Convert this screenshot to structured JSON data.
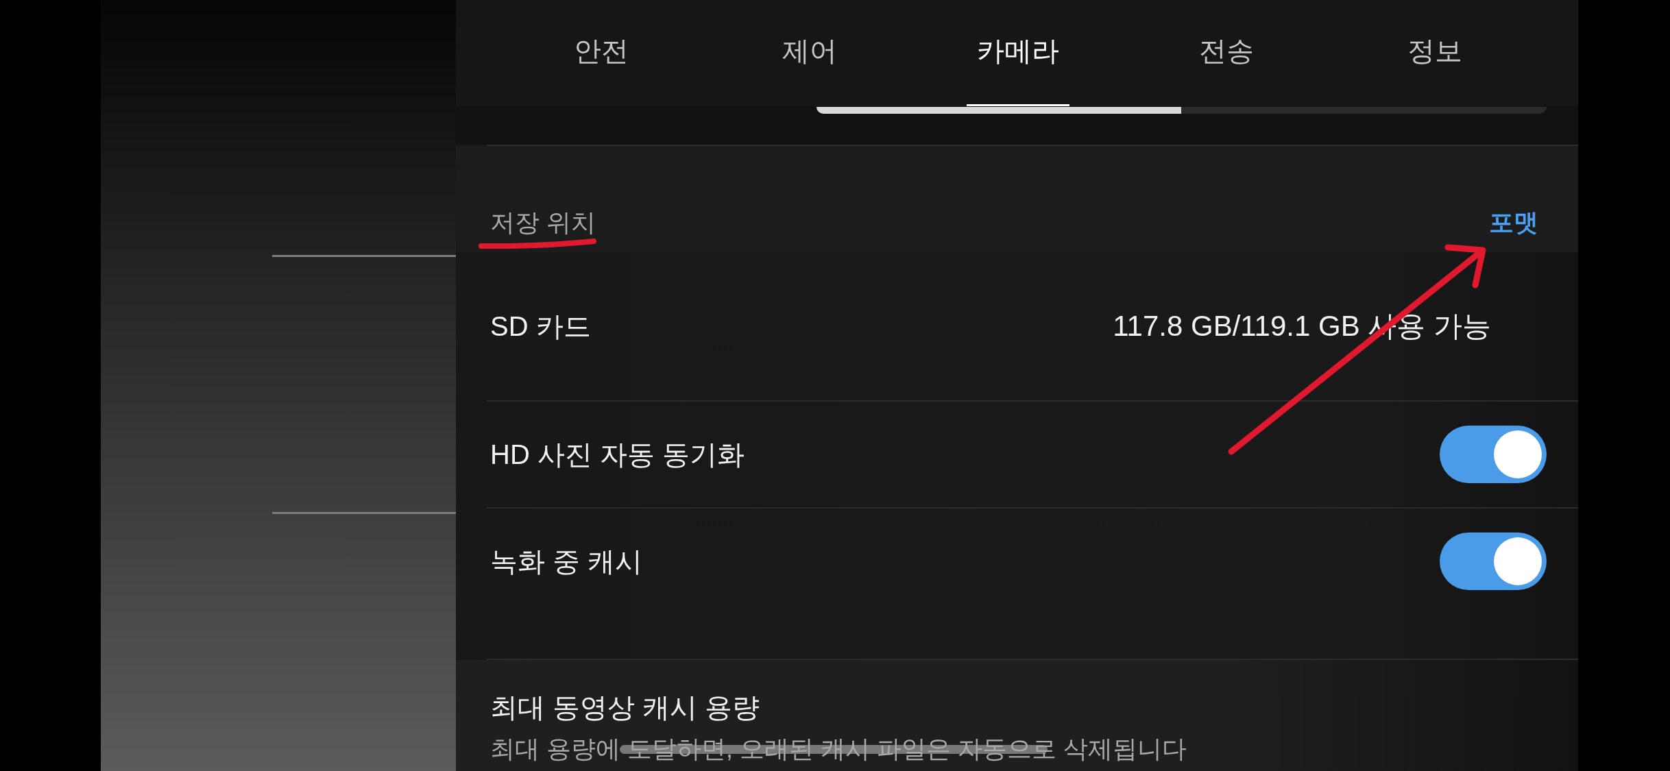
{
  "tabs": [
    {
      "label": "안전",
      "selected": false
    },
    {
      "label": "제어",
      "selected": false
    },
    {
      "label": "카메라",
      "selected": true
    },
    {
      "label": "전송",
      "selected": false
    },
    {
      "label": "정보",
      "selected": false
    }
  ],
  "storage": {
    "header": "저장 위치",
    "action": "포맷",
    "rows": [
      {
        "label": "SD 카드",
        "value": "117.8 GB/119.1 GB 사용 가능"
      }
    ]
  },
  "settings": [
    {
      "kind": "toggle",
      "label": "HD 사진 자동 동기화",
      "on": true
    },
    {
      "kind": "toggle",
      "label": "녹화 중 캐시",
      "on": true
    },
    {
      "kind": "info",
      "title": "최대 동영상 캐시 용량",
      "description": "최대 용량에 도달하면, 오래된 캐시 파일은 자동으로 삭제됩니다"
    }
  ],
  "annotations": [
    {
      "kind": "underline",
      "color": "#e0192f"
    },
    {
      "kind": "arrow",
      "color": "#e0192f"
    },
    {
      "kind": "strike",
      "color": "#787878"
    }
  ]
}
